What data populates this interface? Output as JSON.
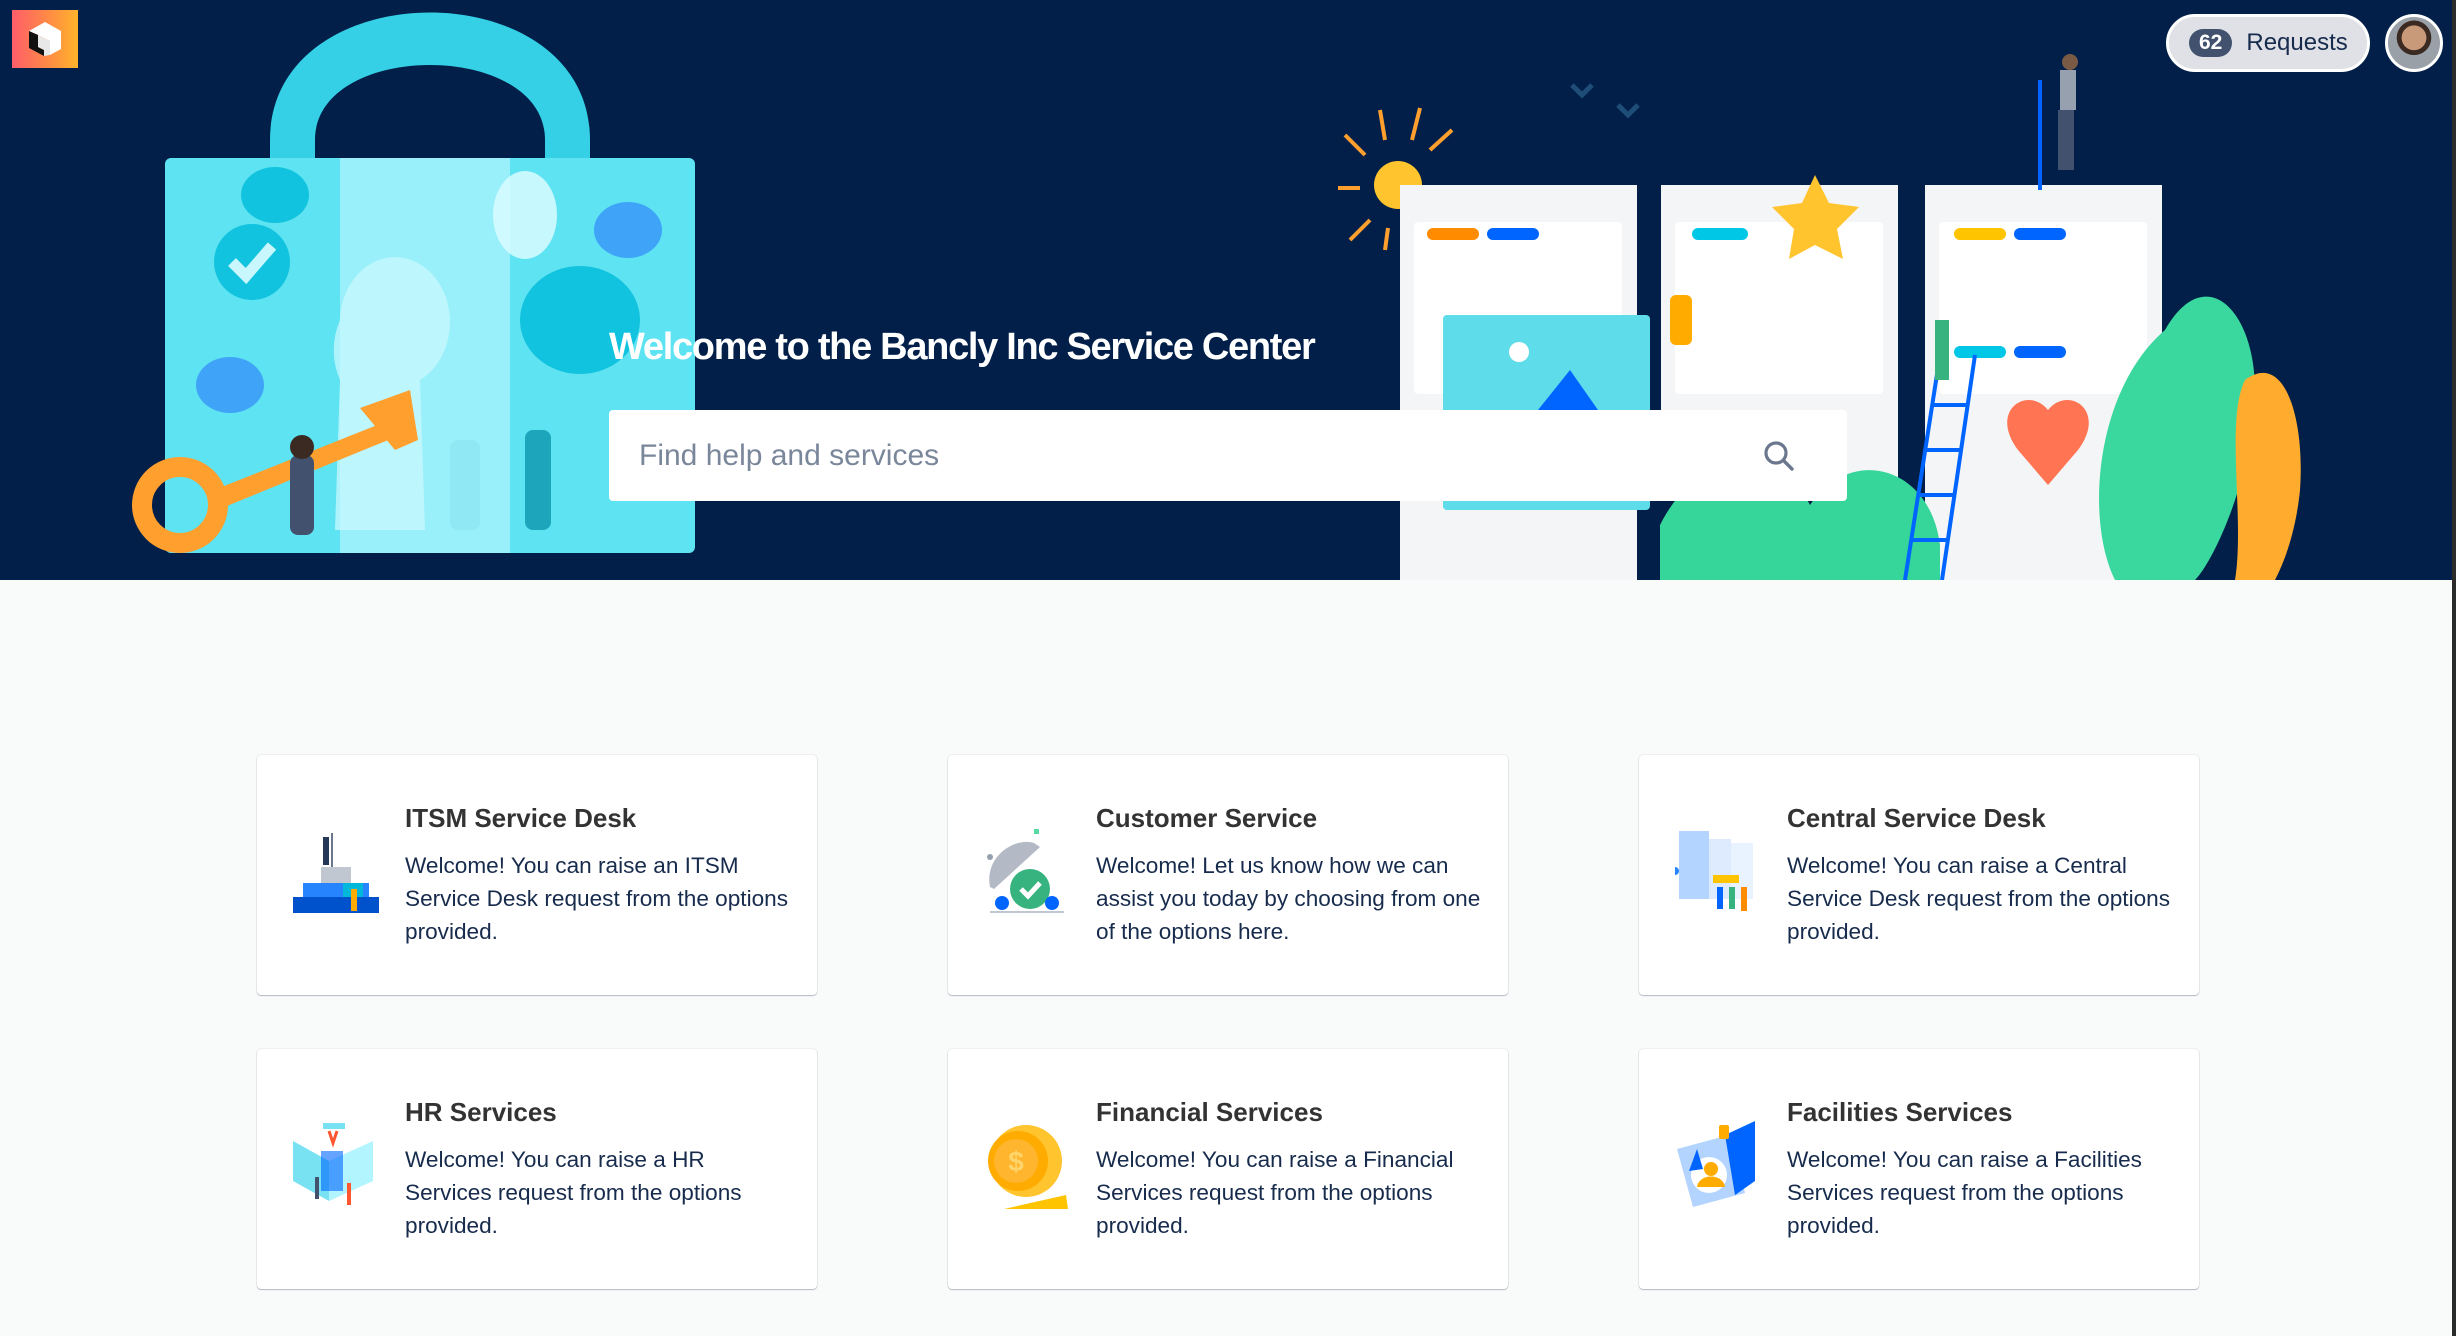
{
  "header": {
    "logo_icon": "service-center-logo-icon",
    "requests": {
      "count": "62",
      "label": "Requests"
    },
    "avatar": "user-avatar"
  },
  "hero": {
    "title": "Welcome to the Bancly Inc Service Center",
    "search": {
      "placeholder": "Find help and services",
      "value": "",
      "icon": "search-icon"
    },
    "illustrations": [
      "padlock-key-illustration",
      "kanban-board-illustration"
    ]
  },
  "colors": {
    "hero_background": "#011f49",
    "page_background": "#f9fafa",
    "card_background": "#ffffff",
    "title_text": "#333333",
    "body_text": "#172b4d",
    "placeholder_text": "#7a869a"
  },
  "service_desks": [
    {
      "title": "ITSM Service Desk",
      "description": "Welcome! You can raise an ITSM Service Desk request from the options provided.",
      "icon": "castle-blocks-icon"
    },
    {
      "title": "Customer Service",
      "description": "Welcome! Let us know how we can assist you today by choosing from one of the options here.",
      "icon": "cloche-checkmark-icon"
    },
    {
      "title": "Central Service Desk",
      "description": "Welcome! You can raise a Central Service Desk request from the options provided.",
      "icon": "board-team-icon"
    },
    {
      "title": "HR Services",
      "description": "Welcome! You can raise a HR Services request from the options provided.",
      "icon": "hr-panels-icon"
    },
    {
      "title": "Financial Services",
      "description": "Welcome! You can raise a Financial Services request from the options provided.",
      "icon": "gold-coin-icon"
    },
    {
      "title": "Facilities Services",
      "description": "Welcome! You can raise a Facilities Services request from the options provided.",
      "icon": "id-badge-icon"
    }
  ]
}
